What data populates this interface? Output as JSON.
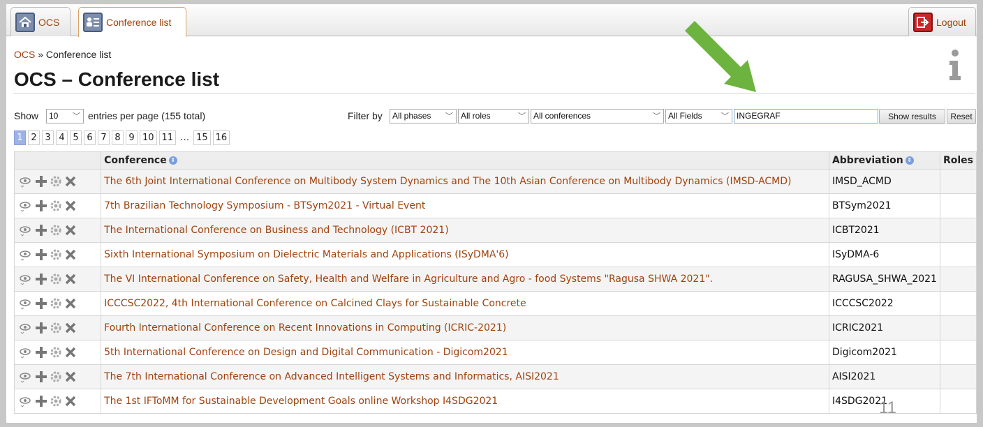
{
  "tabs": [
    {
      "label": "OCS",
      "icon": "home-icon"
    },
    {
      "label": "Conference list",
      "icon": "conference-list-icon"
    }
  ],
  "logout": {
    "label": "Logout",
    "icon": "logout-icon"
  },
  "breadcrumb": {
    "root": "OCS",
    "separator": "»",
    "current": "Conference list"
  },
  "page_title": "OCS – Conference list",
  "controls": {
    "show_label": "Show",
    "entries_per_page": "10",
    "entries_label": "entries per page (155 total)",
    "filter_label": "Filter by",
    "phase_filter": "All phases",
    "role_filter": "All roles",
    "conference_filter": "All conferences",
    "field_filter": "All Fields",
    "search_value": "INGEGRAF",
    "show_results": "Show results",
    "reset": "Reset"
  },
  "pagination": [
    "1",
    "2",
    "3",
    "4",
    "5",
    "6",
    "7",
    "8",
    "9",
    "10",
    "11",
    "…",
    "15",
    "16"
  ],
  "table": {
    "headers": {
      "conference": "Conference",
      "abbreviation": "Abbreviation",
      "roles": "Roles"
    },
    "rows": [
      {
        "conference": "The 6th Joint International Conference on Multibody System Dynamics and The 10th Asian Conference on Multibody Dynamics (IMSD-ACMD)",
        "abbreviation": "IMSD_ACMD"
      },
      {
        "conference": "7th Brazilian Technology Symposium - BTSym2021 - Virtual Event",
        "abbreviation": "BTSym2021"
      },
      {
        "conference": "The International Conference on Business and Technology (ICBT 2021)",
        "abbreviation": "ICBT2021"
      },
      {
        "conference": "Sixth International Symposium on Dielectric Materials and Applications (ISyDMA'6)",
        "abbreviation": "ISyDMA-6"
      },
      {
        "conference": "The VI International Conference on Safety, Health and Welfare in Agriculture and Agro - food Systems \"Ragusa SHWA 2021\".",
        "abbreviation": "RAGUSA_SHWA_2021"
      },
      {
        "conference": "ICCCSC2022, 4th International Conference on Calcined Clays for Sustainable Concrete",
        "abbreviation": "ICCCSC2022"
      },
      {
        "conference": "Fourth International Conference on Recent Innovations in Computing (ICRIC-2021)",
        "abbreviation": "ICRIC2021"
      },
      {
        "conference": "5th International Conference on Design and Digital Communication - Digicom2021",
        "abbreviation": "Digicom2021"
      },
      {
        "conference": "The 7th International Conference on Advanced Intelligent Systems and Informatics, AISI2021",
        "abbreviation": "AISI2021"
      },
      {
        "conference": "The 1st IFToMM for Sustainable Development Goals online Workshop I4SDG2021",
        "abbreviation": "I4SDG2021"
      }
    ]
  },
  "slide_number": "11",
  "colors": {
    "link": "#a0420d",
    "arrow": "#6db33f",
    "page_current": "#9db3e6"
  }
}
